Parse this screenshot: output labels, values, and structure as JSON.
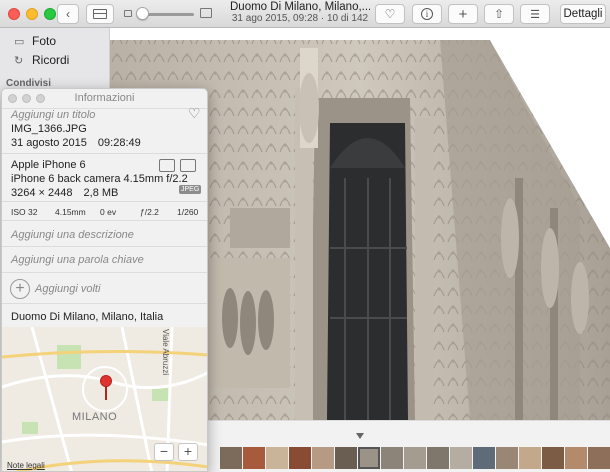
{
  "toolbar": {
    "title": "Duomo Di Milano, Milano,...",
    "subtitle_date": "31 ago 2015, 09:28",
    "subtitle_sep": " · ",
    "subtitle_count": "10 di 142",
    "details_label": "Dettagli",
    "icons": [
      "back-chevron-icon",
      "sidebar-toggle-icon",
      "zoom-slider",
      "heart-icon",
      "info-icon",
      "add-icon",
      "share-icon",
      "adjust-icon"
    ]
  },
  "sidebar": {
    "items": [
      {
        "label": "Foto",
        "icon": "photos-icon"
      },
      {
        "label": "Ricordi",
        "icon": "memories-icon"
      }
    ],
    "shared_header": "Condivisi"
  },
  "info_panel": {
    "window_title": "Informazioni",
    "title_placeholder": "Aggiungi un titolo",
    "filename": "IMG_1366.JPG",
    "date": "31 agosto 2015",
    "time": "09:28:49",
    "camera_model": "Apple iPhone 6",
    "lens": "iPhone 6 back camera 4.15mm f/2.2",
    "dimensions": "3264 × 2448",
    "file_size": "2,8 MB",
    "format_badge": "JPEG",
    "exif": {
      "iso": "ISO 32",
      "focal_length": "4.15mm",
      "exposure_bias": "0 ev",
      "aperture": "ƒ/2.2",
      "shutter": "1/260"
    },
    "description_placeholder": "Aggiungi una descrizione",
    "keyword_placeholder": "Aggiungi una parola chiave",
    "faces_placeholder": "Aggiungi volti",
    "location": "Duomo Di Milano, Milano, Italia",
    "map": {
      "city_label": "MILANO",
      "street_label": "Viale Abruzzi",
      "legal_link": "Note legali",
      "zoom_out": "−",
      "zoom_in": "+"
    }
  },
  "colors": {
    "accent_pin": "#e0322e",
    "sidebar_bg": "#e6e6e8",
    "panel_bg": "#f1f1f1"
  }
}
